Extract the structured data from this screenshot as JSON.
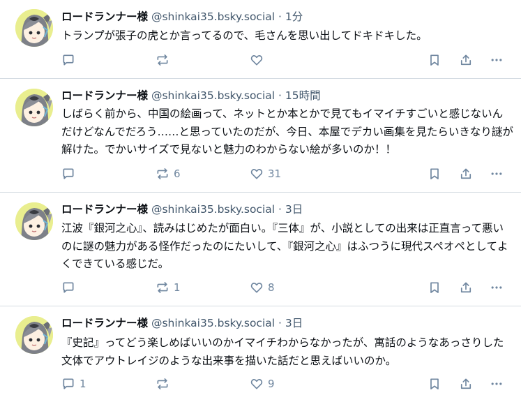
{
  "posts": [
    {
      "author": "ロードランナー様",
      "handle": "@shinkai35.bsky.social",
      "separator": "·",
      "time": "1分",
      "text": "トランプが張子の虎とか言ってるので、毛さんを思い出してドキドキした。",
      "reply_count": "",
      "repost_count": "",
      "like_count": ""
    },
    {
      "author": "ロードランナー様",
      "handle": "@shinkai35.bsky.social",
      "separator": "·",
      "time": "15時間",
      "text": "しばらく前から、中国の絵画って、ネットとか本とかで見てもイマイチすごいと感じないんだけどなんでだろう……と思っていたのだが、今日、本屋でデカい画集を見たらいきなり謎が解けた。でかいサイズで見ないと魅力のわからない絵が多いのか！！",
      "reply_count": "",
      "repost_count": "6",
      "like_count": "31"
    },
    {
      "author": "ロードランナー様",
      "handle": "@shinkai35.bsky.social",
      "separator": "·",
      "time": "3日",
      "text": "江波『銀河之心』、読みはじめたが面白い。『三体』が、小説としての出来は正直言って悪いのに謎の魅力がある怪作だったのにたいして、『銀河之心』はふつうに現代スペオペとしてよくできている感じだ。",
      "reply_count": "",
      "repost_count": "1",
      "like_count": "8"
    },
    {
      "author": "ロードランナー様",
      "handle": "@shinkai35.bsky.social",
      "separator": "·",
      "time": "3日",
      "text": "『史記』ってどう楽しめばいいのかイマイチわからなかったが、寓話のようなあっさりした文体でアウトレイジのような出来事を描いた話だと思えばいいのか。",
      "reply_count": "1",
      "repost_count": "",
      "like_count": "9"
    }
  ],
  "icons": {
    "reply": "speech-bubble-icon",
    "repost": "repost-arrows-icon",
    "like": "heart-icon",
    "bookmark": "bookmark-icon",
    "share": "share-upload-icon",
    "more": "more-dots-icon"
  },
  "colors": {
    "text": "#0b0f14",
    "muted": "#42576c",
    "icon": "#6f869f",
    "divider": "#d4dbe2",
    "avatar_bg": "#e9ee8f"
  }
}
